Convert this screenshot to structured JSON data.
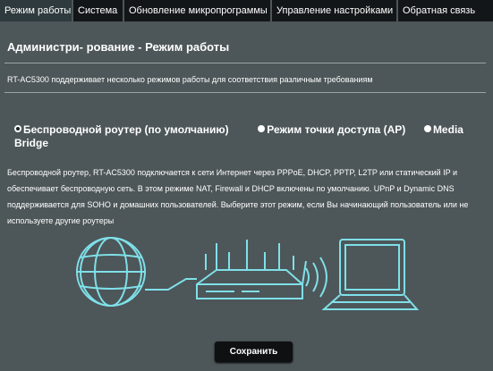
{
  "tabs": [
    {
      "label": "Режим работы",
      "active": true
    },
    {
      "label": "Система",
      "active": false
    },
    {
      "label": "Обновление микропрограммы",
      "active": false
    },
    {
      "label": "Управление настройками",
      "active": false
    },
    {
      "label": "Обратная связь",
      "active": false
    }
  ],
  "page_title": "Администри- рование - Режим работы",
  "intro_text": "RT-AC5300 поддерживает несколько режимов работы для соответствия различным требованиям",
  "modes": [
    {
      "label": "Беспроводной роутер (по умолчанию)",
      "selected": true
    },
    {
      "label": "Режим точки доступа (AP)",
      "selected": false
    },
    {
      "label": "Media Bridge",
      "selected": false
    }
  ],
  "mode_description": "Беспроводной роутер, RT-AC5300 подключается к сети Интернет через PPPoE, DHCP, PPTP, L2TP или статический IP и обеспечивает беспроводную сеть. В этом режиме NAT, Firewall и DHCP включены по умолчанию. UPnP и Dynamic DNS поддерживается для SOHO и домашних пользователей. Выберите этот режим, если Вы начинающий пользователь или не используете другие роутеры",
  "save_label": "Сохранить",
  "colors": {
    "background": "#4d5659",
    "tab_bg": "#131618",
    "active_tab_bg": "#2f3a3e",
    "illustration": "#7fe0e8"
  },
  "illustration_icons": [
    "globe-icon",
    "router-icon",
    "wifi-waves-icon",
    "laptop-icon"
  ]
}
